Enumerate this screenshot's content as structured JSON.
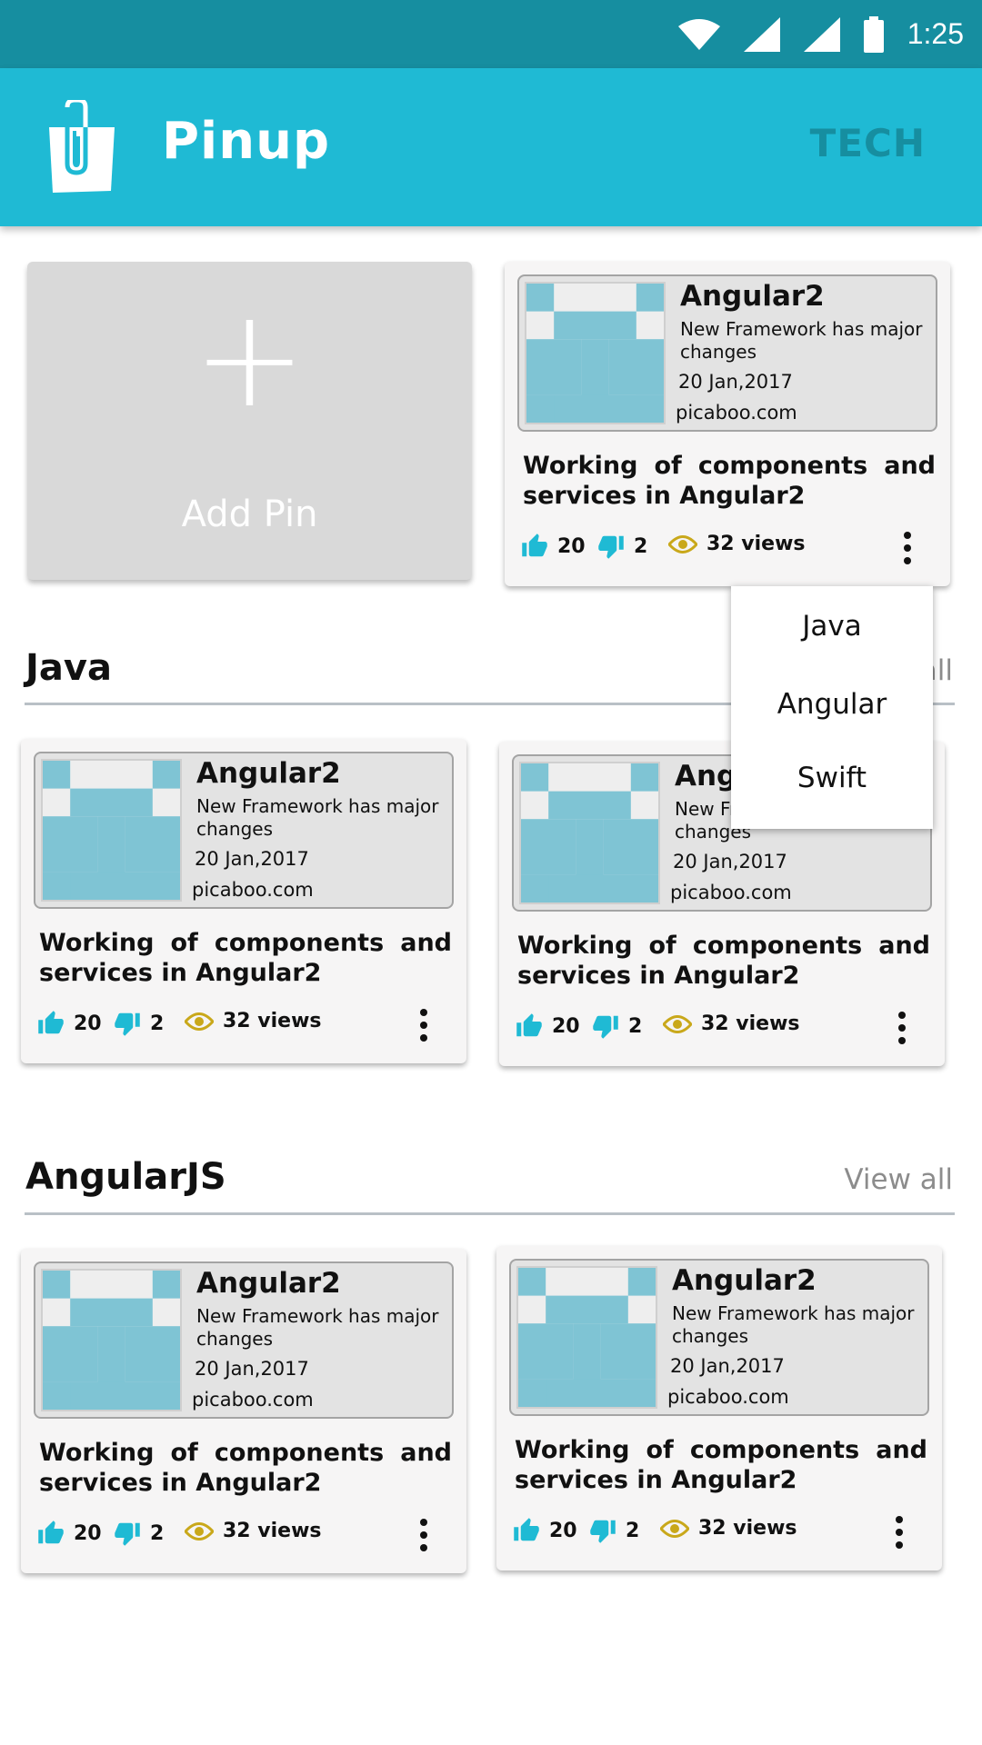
{
  "status_bar": {
    "time": "1:25"
  },
  "app_bar": {
    "title": "Pinup",
    "tab": "TECH"
  },
  "add_pin": {
    "plus": "+",
    "label": "Add Pin"
  },
  "icon_names": {
    "logo": "shopping-bag-paperclip-icon",
    "like": "thumbs-up-icon",
    "dislike": "thumbs-down-icon",
    "views": "eye-icon",
    "more": "more-vert-icon"
  },
  "colors": {
    "status_bar": "#168ea0",
    "app_bar": "#1fbad4",
    "accent": "#1fbad4",
    "thumb_tile": "#7fc4d4",
    "eye": "#c9a81a"
  },
  "sections": [
    {
      "title": "Java",
      "view_all": "View all"
    },
    {
      "title": "AngularJS",
      "view_all": "View all"
    }
  ],
  "cards": [
    {
      "title": "Angular2",
      "desc": "New Framework has major changes",
      "date": "20 Jan,2017",
      "source": "picaboo.com",
      "text": "Working of  components and services in Angular2",
      "likes": "20",
      "dislikes": "2",
      "views": "32 views"
    },
    {
      "title": "Angular2",
      "desc": "New Framework has major changes",
      "date": "20 Jan,2017",
      "source": "picaboo.com",
      "text": "Working of  components and services in Angular2",
      "likes": "20",
      "dislikes": "2",
      "views": "32 views"
    },
    {
      "title": "Angular2",
      "desc": "New Framework has major changes",
      "date": "20 Jan,2017",
      "source": "picaboo.com",
      "text": "Working of  components and services in Angular2",
      "likes": "20",
      "dislikes": "2",
      "views": "32 views"
    },
    {
      "title": "Angular2",
      "desc": "New Framework has major changes",
      "date": "20 Jan,2017",
      "source": "picaboo.com",
      "text": "Working of  components and services in Angular2",
      "likes": "20",
      "dislikes": "2",
      "views": "32 views"
    },
    {
      "title": "Angular2",
      "desc": "New Framework has major changes",
      "date": "20 Jan,2017",
      "source": "picaboo.com",
      "text": "Working of  components and services in Angular2",
      "likes": "20",
      "dislikes": "2",
      "views": "32 views"
    }
  ],
  "dropdown": {
    "items": [
      "Java",
      "Angular",
      "Swift"
    ]
  }
}
